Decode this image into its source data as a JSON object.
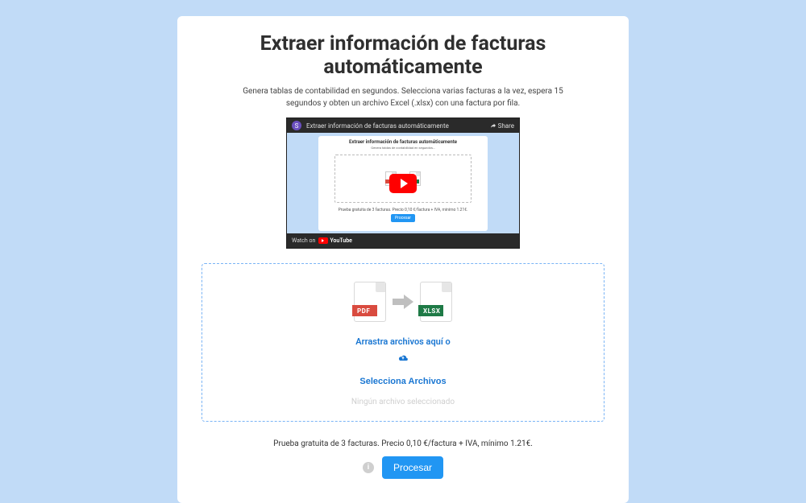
{
  "page": {
    "title": "Extraer información de facturas automáticamente",
    "subtitle": "Genera tablas de contabilidad en segundos. Selecciona varias facturas a la vez, espera 15 segundos y obten un archivo Excel (.xlsx) con una factura por fila."
  },
  "video": {
    "avatar_letter": "S",
    "title": "Extraer información de facturas automáticamente",
    "share": "Share",
    "watch_on": "Watch on",
    "youtube": "YouTube",
    "mini_title": "Extraer información de facturas automáticamente",
    "mini_process": "Procesar"
  },
  "dropzone": {
    "pdf_label": "PDF",
    "xlsx_label": "XLSX",
    "drag_text": "Arrastra archivos aquí o",
    "select_button": "Selecciona Archivos",
    "no_file": "Ningún archivo seleccionado"
  },
  "footer": {
    "trial_text": "Prueba gratuita de 3 facturas. Precio 0,10 €/factura + IVA, mínimo 1.21€.",
    "info_char": "i",
    "process_button": "Procesar"
  }
}
